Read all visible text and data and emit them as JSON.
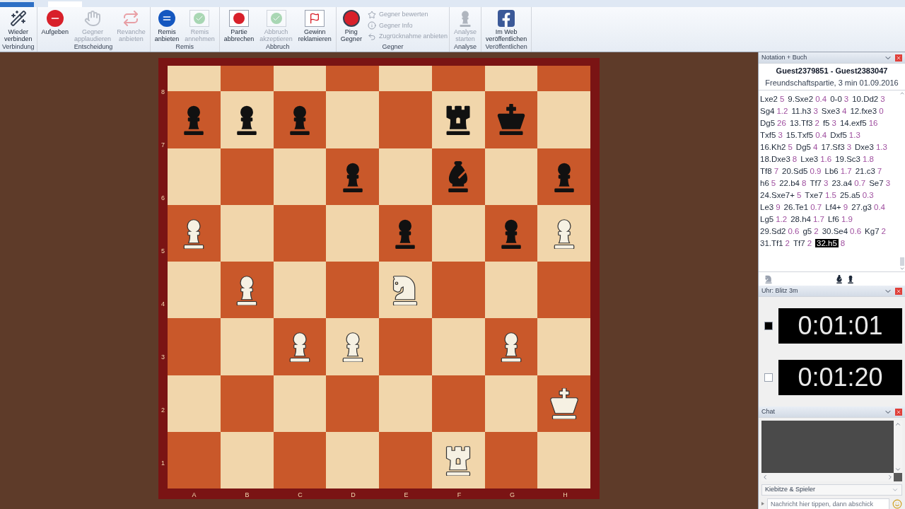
{
  "ribbon": {
    "groups": [
      {
        "label": "Verbindung",
        "buttons": [
          {
            "kind": "wand",
            "lines": [
              "Wieder",
              "verbinden"
            ],
            "disabled": false
          }
        ]
      },
      {
        "label": "Entscheidung",
        "buttons": [
          {
            "kind": "resign",
            "lines": [
              "Aufgeben"
            ],
            "disabled": false
          },
          {
            "kind": "applause",
            "lines": [
              "Gegner",
              "applaudieren"
            ],
            "disabled": true
          },
          {
            "kind": "rematch",
            "lines": [
              "Revanche",
              "anbieten"
            ],
            "disabled": true
          }
        ]
      },
      {
        "label": "Remis",
        "buttons": [
          {
            "kind": "draw",
            "lines": [
              "Remis",
              "anbieten"
            ],
            "disabled": false
          },
          {
            "kind": "accept",
            "lines": [
              "Remis",
              "annehmen"
            ],
            "disabled": true
          }
        ]
      },
      {
        "label": "Abbruch",
        "buttons": [
          {
            "kind": "abort",
            "lines": [
              "Partie",
              "abbrechen"
            ],
            "disabled": false
          },
          {
            "kind": "accept",
            "lines": [
              "Abbruch",
              "akzeptieren"
            ],
            "disabled": true
          },
          {
            "kind": "claim",
            "lines": [
              "Gewinn",
              "reklamieren"
            ],
            "disabled": false
          }
        ]
      },
      {
        "label": "Gegner",
        "buttons": [
          {
            "kind": "ping",
            "lines": [
              "Ping",
              "Gegner"
            ],
            "disabled": false
          }
        ],
        "small": [
          {
            "kind": "rate",
            "label": "Gegner bewerten",
            "disabled": true
          },
          {
            "kind": "info",
            "label": "Gegner Info",
            "disabled": true
          },
          {
            "kind": "takeback",
            "label": "Zugrücknahme anbieten",
            "disabled": true
          }
        ]
      },
      {
        "label": "Analyse",
        "buttons": [
          {
            "kind": "analysis",
            "lines": [
              "Analyse",
              "starten"
            ],
            "disabled": true
          }
        ]
      },
      {
        "label": "Veröffentlichen",
        "buttons": [
          {
            "kind": "publish",
            "lines": [
              "Im Web",
              "veröffentlichen"
            ],
            "disabled": false
          }
        ]
      }
    ]
  },
  "board": {
    "ranks": [
      "8",
      "7",
      "6",
      "5",
      "4",
      "3",
      "2",
      "1"
    ],
    "files": [
      "A",
      "B",
      "C",
      "D",
      "E",
      "F",
      "G",
      "H"
    ],
    "rows": [
      [
        {
          "kind": "empty"
        },
        {
          "kind": "empty"
        },
        {
          "kind": "empty"
        },
        {
          "kind": "empty"
        },
        {
          "kind": "empty"
        },
        {
          "kind": "empty"
        },
        {
          "kind": "empty"
        },
        {
          "kind": "empty"
        }
      ],
      [
        {
          "kind": "black-pawn"
        },
        {
          "kind": "black-pawn"
        },
        {
          "kind": "black-pawn"
        },
        {
          "kind": "empty"
        },
        {
          "kind": "empty"
        },
        {
          "kind": "black-rook"
        },
        {
          "kind": "black-king"
        },
        {
          "kind": "empty"
        }
      ],
      [
        {
          "kind": "empty"
        },
        {
          "kind": "empty"
        },
        {
          "kind": "empty"
        },
        {
          "kind": "black-pawn"
        },
        {
          "kind": "empty"
        },
        {
          "kind": "black-bishop"
        },
        {
          "kind": "empty"
        },
        {
          "kind": "black-pawn"
        }
      ],
      [
        {
          "kind": "white-pawn"
        },
        {
          "kind": "empty"
        },
        {
          "kind": "empty"
        },
        {
          "kind": "empty"
        },
        {
          "kind": "black-pawn"
        },
        {
          "kind": "empty"
        },
        {
          "kind": "black-pawn"
        },
        {
          "kind": "white-pawn"
        }
      ],
      [
        {
          "kind": "empty"
        },
        {
          "kind": "white-pawn"
        },
        {
          "kind": "empty"
        },
        {
          "kind": "empty"
        },
        {
          "kind": "white-knight"
        },
        {
          "kind": "empty"
        },
        {
          "kind": "empty"
        },
        {
          "kind": "empty"
        }
      ],
      [
        {
          "kind": "empty"
        },
        {
          "kind": "empty"
        },
        {
          "kind": "white-pawn"
        },
        {
          "kind": "white-pawn"
        },
        {
          "kind": "empty"
        },
        {
          "kind": "empty"
        },
        {
          "kind": "white-pawn"
        },
        {
          "kind": "empty"
        }
      ],
      [
        {
          "kind": "empty"
        },
        {
          "kind": "empty"
        },
        {
          "kind": "empty"
        },
        {
          "kind": "empty"
        },
        {
          "kind": "empty"
        },
        {
          "kind": "empty"
        },
        {
          "kind": "empty"
        },
        {
          "kind": "white-king"
        }
      ],
      [
        {
          "kind": "empty"
        },
        {
          "kind": "empty"
        },
        {
          "kind": "empty"
        },
        {
          "kind": "empty"
        },
        {
          "kind": "empty"
        },
        {
          "kind": "white-rook"
        },
        {
          "kind": "empty"
        },
        {
          "kind": "empty"
        }
      ]
    ]
  },
  "notation": {
    "title": "Notation + Buch",
    "players": "Guest2379851 - Guest2383047",
    "event": "Freundschaftspartie, 3 min 01.09.2016",
    "moves": [
      {
        "move": "Lxe2",
        "time": "5",
        "selected": false
      },
      {
        "move": "9.Sxe2",
        "time": "0.4",
        "selected": false
      },
      {
        "move": "0-0",
        "time": "3",
        "selected": false
      },
      {
        "move": "10.Dd2",
        "time": "3",
        "selected": false
      },
      {
        "move": "Sg4",
        "time": "1.2",
        "selected": false
      },
      {
        "move": "11.h3",
        "time": "3",
        "selected": false
      },
      {
        "move": "Sxe3",
        "time": "4",
        "selected": false
      },
      {
        "move": "12.fxe3",
        "time": "0",
        "selected": false
      },
      {
        "move": "Dg5",
        "time": "26",
        "selected": false
      },
      {
        "move": "13.Tf3",
        "time": "2",
        "selected": false
      },
      {
        "move": "f5",
        "time": "3",
        "selected": false
      },
      {
        "move": "14.exf5",
        "time": "16",
        "selected": false
      },
      {
        "move": "Txf5",
        "time": "3",
        "selected": false
      },
      {
        "move": "15.Txf5",
        "time": "0.4",
        "selected": false
      },
      {
        "move": "Dxf5",
        "time": "1.3",
        "selected": false
      },
      {
        "move": "16.Kh2",
        "time": "5",
        "selected": false
      },
      {
        "move": "Dg5",
        "time": "4",
        "selected": false
      },
      {
        "move": "17.Sf3",
        "time": "3",
        "selected": false
      },
      {
        "move": "Dxe3",
        "time": "1.3",
        "selected": false
      },
      {
        "move": "18.Dxe3",
        "time": "8",
        "selected": false
      },
      {
        "move": "Lxe3",
        "time": "1.6",
        "selected": false
      },
      {
        "move": "19.Sc3",
        "time": "1.8",
        "selected": false
      },
      {
        "move": "Tf8",
        "time": "7",
        "selected": false
      },
      {
        "move": "20.Sd5",
        "time": "0.9",
        "selected": false
      },
      {
        "move": "Lb6",
        "time": "1.7",
        "selected": false
      },
      {
        "move": "21.c3",
        "time": "7",
        "selected": false
      },
      {
        "move": "h6",
        "time": "5",
        "selected": false
      },
      {
        "move": "22.b4",
        "time": "8",
        "selected": false
      },
      {
        "move": "Tf7",
        "time": "3",
        "selected": false
      },
      {
        "move": "23.a4",
        "time": "0.7",
        "selected": false
      },
      {
        "move": "Se7",
        "time": "3",
        "selected": false
      },
      {
        "move": "24.Sxe7+",
        "time": "5",
        "selected": false
      },
      {
        "move": "Txe7",
        "time": "1.5",
        "selected": false
      },
      {
        "move": "25.a5",
        "time": "0.3",
        "selected": false
      },
      {
        "move": "Le3",
        "time": "9",
        "selected": false
      },
      {
        "move": "26.Te1",
        "time": "0.7",
        "selected": false
      },
      {
        "move": "Lf4+",
        "time": "9",
        "selected": false
      },
      {
        "move": "27.g3",
        "time": "0.4",
        "selected": false
      },
      {
        "move": "Lg5",
        "time": "1.2",
        "selected": false
      },
      {
        "move": "28.h4",
        "time": "1.7",
        "selected": false
      },
      {
        "move": "Lf6",
        "time": "1.9",
        "selected": false
      },
      {
        "move": "29.Sd2",
        "time": "0.6",
        "selected": false
      },
      {
        "move": "g5",
        "time": "2",
        "selected": false
      },
      {
        "move": "30.Se4",
        "time": "0.6",
        "selected": false
      },
      {
        "move": "Kg7",
        "time": "2",
        "selected": false
      },
      {
        "move": "31.Tf1",
        "time": "2",
        "selected": false
      },
      {
        "move": "Tf7",
        "time": "2",
        "selected": false
      },
      {
        "move": "32.h5",
        "time": "8",
        "selected": true
      }
    ]
  },
  "clock": {
    "title": "Uhr: Blitz 3m",
    "players": [
      {
        "kind": "black",
        "time": "0:01:01"
      },
      {
        "kind": "white",
        "time": "0:01:20"
      }
    ]
  },
  "chat": {
    "title": "Chat",
    "audience": "Kiebitze & Spieler",
    "placeholder": "Nachricht hier tippen, dann abschick"
  }
}
